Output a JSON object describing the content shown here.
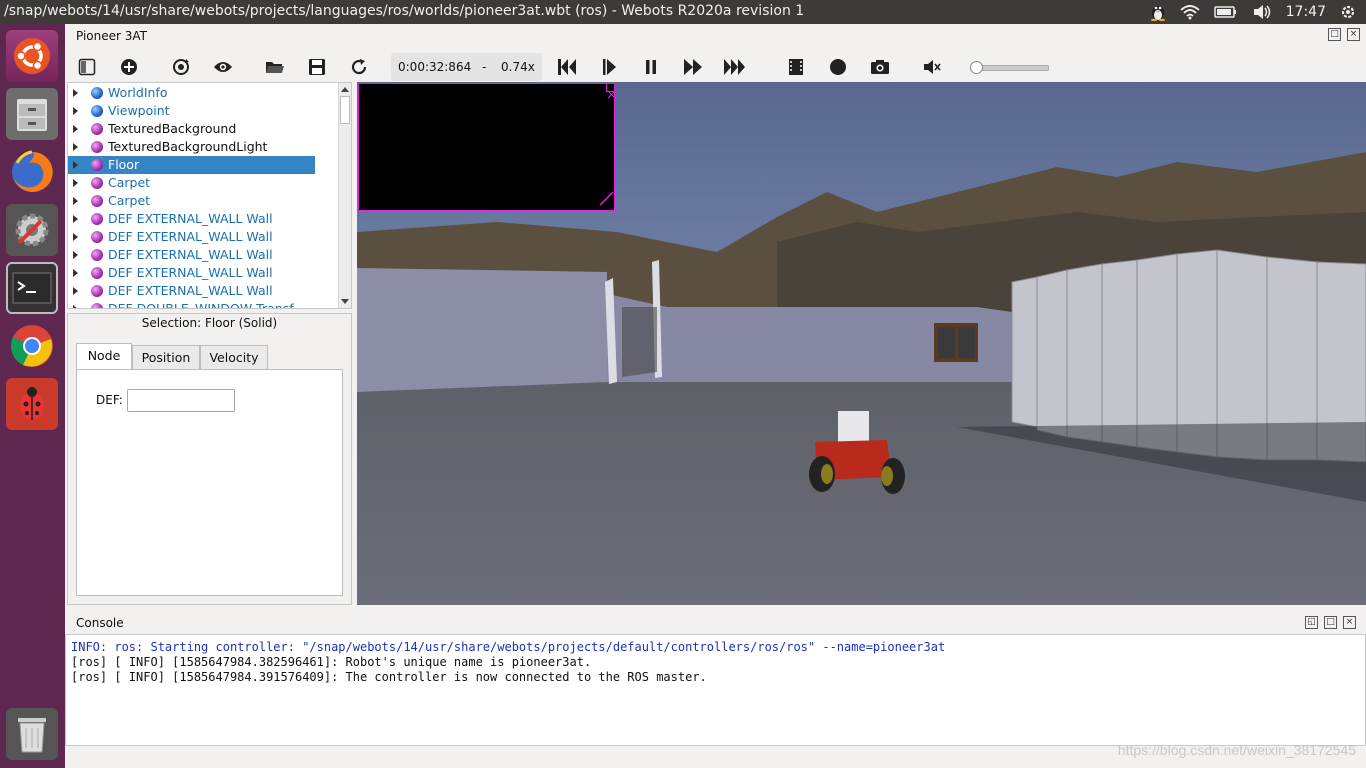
{
  "topbar": {
    "title": "/snap/webots/14/usr/share/webots/projects/languages/ros/worlds/pioneer3at.wbt (ros) - Webots R2020a revision 1",
    "time": "17:47"
  },
  "launcher": {
    "items": [
      "ubuntu-logo-icon",
      "files-icon",
      "firefox-icon",
      "settings-icon",
      "terminal-icon",
      "chrome-icon",
      "webots-bug-icon",
      "trash-icon"
    ]
  },
  "window": {
    "title": "Pioneer 3AT"
  },
  "toolbar": {
    "time": "0:00:32:864",
    "separator": "-",
    "speed": "0.74x"
  },
  "tree": {
    "items": [
      {
        "label": "WorldInfo",
        "ball": "blue"
      },
      {
        "label": "Viewpoint",
        "ball": "blue"
      },
      {
        "label": "TexturedBackground",
        "ball": "purple"
      },
      {
        "label": "TexturedBackgroundLight",
        "ball": "purple"
      },
      {
        "label": "Floor",
        "ball": "purple"
      },
      {
        "label": "Carpet",
        "ball": "purple"
      },
      {
        "label": "Carpet",
        "ball": "purple"
      },
      {
        "label": "DEF EXTERNAL_WALL Wall",
        "ball": "purple"
      },
      {
        "label": "DEF EXTERNAL_WALL Wall",
        "ball": "purple"
      },
      {
        "label": "DEF EXTERNAL_WALL Wall",
        "ball": "purple"
      },
      {
        "label": "DEF EXTERNAL_WALL Wall",
        "ball": "purple"
      },
      {
        "label": "DEF EXTERNAL_WALL Wall",
        "ball": "purple"
      },
      {
        "label": "DEF DOUBLE_WINDOW Transf",
        "ball": "purple"
      }
    ]
  },
  "editor": {
    "selection": "Selection: Floor (Solid)",
    "tabs": [
      "Node",
      "Position",
      "Velocity"
    ],
    "def_label": "DEF:",
    "def_value": ""
  },
  "console": {
    "title": "Console",
    "lines": [
      "INFO: ros: Starting controller: \"/snap/webots/14/usr/share/webots/projects/default/controllers/ros/ros\" --name=pioneer3at",
      "[ros] [ INFO] [1585647984.382596461]: Robot's unique name is pioneer3at.",
      "[ros] [ INFO] [1585647984.391576409]: The controller is now connected to the ROS master."
    ],
    "watermark": "https://blog.csdn.net/weixin_38172545"
  },
  "colors": {
    "launcher_bg": "#5e2750",
    "topbar_bg": "#3c3b37",
    "selection_bg": "#3584c4",
    "tree_text": "#1b6fae",
    "console_info": "#1c33b3"
  }
}
